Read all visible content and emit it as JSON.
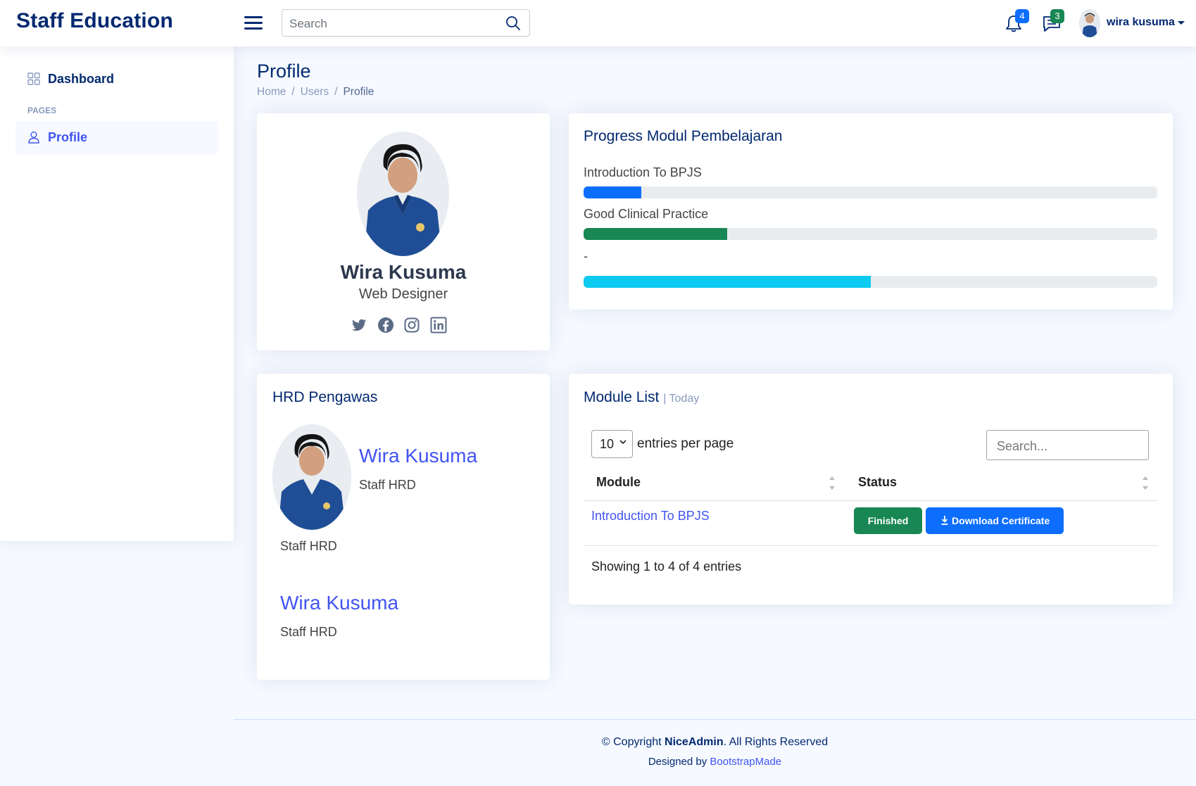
{
  "header": {
    "brand": "Staff Education",
    "search_placeholder": "Search",
    "notifications_count": "4",
    "messages_count": "3",
    "username": "wira kusuma",
    "colors": {
      "brand": "#012970",
      "notif_badge": "#0d6efd",
      "msg_badge": "#198754"
    }
  },
  "sidebar": {
    "dashboard_label": "Dashboard",
    "pages_heading": "PAGES",
    "profile_label": "Profile"
  },
  "page": {
    "title": "Profile",
    "breadcrumb": {
      "home": "Home",
      "users": "Users",
      "current": "Profile"
    }
  },
  "profile_card": {
    "name": "Wira Kusuma",
    "role": "Web Designer",
    "social_icons": [
      "twitter-icon",
      "facebook-icon",
      "instagram-icon",
      "linkedin-icon"
    ]
  },
  "progress_card": {
    "title": "Progress Modul Pembelajaran",
    "items": [
      {
        "label": "Introduction To BPJS",
        "percent": 10,
        "color": "#0d6efd"
      },
      {
        "label": "Good Clinical Practice",
        "percent": 25,
        "color": "#198754"
      },
      {
        "label": "-",
        "percent": 50,
        "color": "#0dcaf0"
      }
    ]
  },
  "hrd_card": {
    "title": "HRD Pengawas",
    "supervisors": [
      {
        "name": "Wira Kusuma",
        "role": "Staff HRD",
        "extra_role": "Staff HRD"
      },
      {
        "name": "Wira Kusuma",
        "role": "Staff HRD"
      }
    ]
  },
  "module_card": {
    "title": "Module List",
    "subtitle": "| Today",
    "entries_value": "10",
    "entries_label": "entries per page",
    "search_placeholder": "Search...",
    "columns": [
      "Module",
      "Status"
    ],
    "rows": [
      {
        "module": "Introduction To BPJS",
        "status": "Finished",
        "action": "Download Certificate"
      }
    ],
    "info": "Showing 1 to 4 of 4 entries"
  },
  "footer": {
    "copyright_prefix": "© Copyright ",
    "copyright_brand": "NiceAdmin",
    "copyright_suffix": ". All Rights Reserved",
    "designed_prefix": "Designed by ",
    "designed_link": "BootstrapMade"
  }
}
